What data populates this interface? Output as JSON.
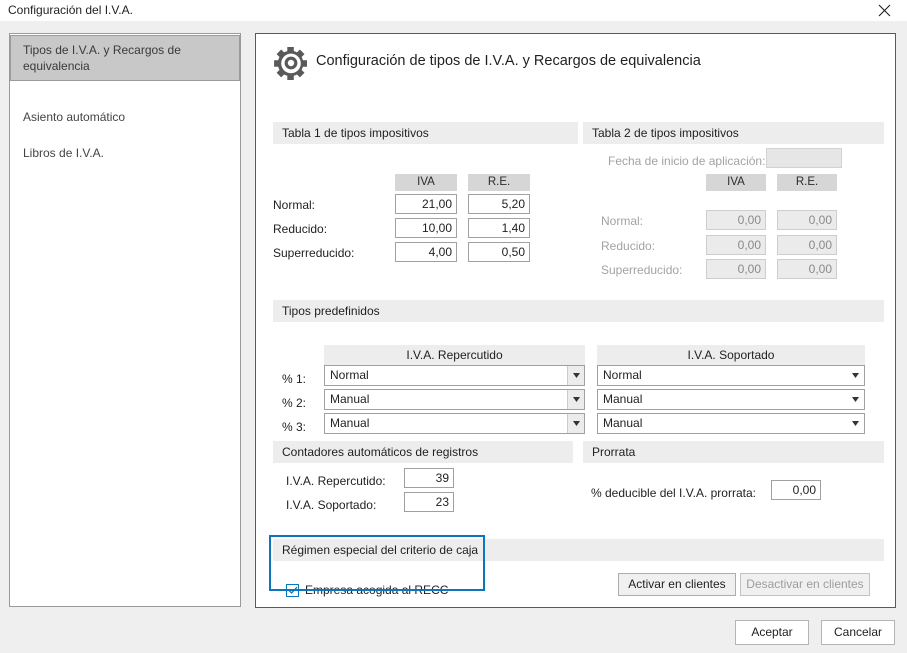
{
  "window": {
    "title": "Configuración del I.V.A.",
    "close_icon": "close-icon"
  },
  "sidebar": {
    "items": [
      {
        "label": "Tipos de I.V.A. y Recargos de equivalencia",
        "selected": true
      },
      {
        "label": "Asiento automático",
        "selected": false
      },
      {
        "label": "Libros de I.V.A.",
        "selected": false
      }
    ]
  },
  "header": {
    "icon": "gear-icon",
    "title": "Configuración de tipos de I.V.A. y Recargos de equivalencia"
  },
  "tabla1": {
    "band_title": "Tabla 1 de tipos impositivos",
    "col_iva": "IVA",
    "col_re": "R.E.",
    "rows": [
      {
        "label": "Normal:",
        "iva": "21,00",
        "re": "5,20"
      },
      {
        "label": "Reducido:",
        "iva": "10,00",
        "re": "1,40"
      },
      {
        "label": "Superreducido:",
        "iva": "4,00",
        "re": "0,50"
      }
    ]
  },
  "tabla2": {
    "band_title": "Tabla 2 de tipos impositivos",
    "fecha_label": "Fecha de inicio de aplicación:",
    "fecha_value": "",
    "col_iva": "IVA",
    "col_re": "R.E.",
    "rows": [
      {
        "label": "Normal:",
        "iva": "0,00",
        "re": "0,00"
      },
      {
        "label": "Reducido:",
        "iva": "0,00",
        "re": "0,00"
      },
      {
        "label": "Superreducido:",
        "iva": "0,00",
        "re": "0,00"
      }
    ]
  },
  "tipos_predefinidos": {
    "band_title": "Tipos predefinidos",
    "col_repercutido": "I.V.A. Repercutido",
    "col_soportado": "I.V.A. Soportado",
    "rows": [
      {
        "label": "% 1:",
        "repercutido": "Normal",
        "soportado": "Normal"
      },
      {
        "label": "% 2:",
        "repercutido": "Manual",
        "soportado": "Manual"
      },
      {
        "label": "% 3:",
        "repercutido": "Manual",
        "soportado": "Manual"
      }
    ]
  },
  "contadores": {
    "band_title": "Contadores automáticos de registros",
    "repercutido_label": "I.V.A. Repercutido:",
    "repercutido_value": "39",
    "soportado_label": "I.V.A. Soportado:",
    "soportado_value": "23"
  },
  "prorrata": {
    "band_title": "Prorrata",
    "deducible_label": "% deducible del I.V.A. prorrata:",
    "deducible_value": "0,00"
  },
  "recc": {
    "band_title": "Régimen especial del criterio de caja",
    "checkbox_label": "Empresa acogida al RECC",
    "checkbox_checked": true,
    "activar_label": "Activar en clientes",
    "desactivar_label": "Desactivar en clientes",
    "desactivar_disabled": true
  },
  "dialog_buttons": {
    "accept_label": "Aceptar",
    "cancel_label": "Cancelar"
  },
  "colors": {
    "accent": "#0c76bc",
    "band": "#ededed",
    "colhead": "#d6d6d6",
    "sidebar_selected": "#c8c8c8",
    "window_bg": "#efefef"
  }
}
